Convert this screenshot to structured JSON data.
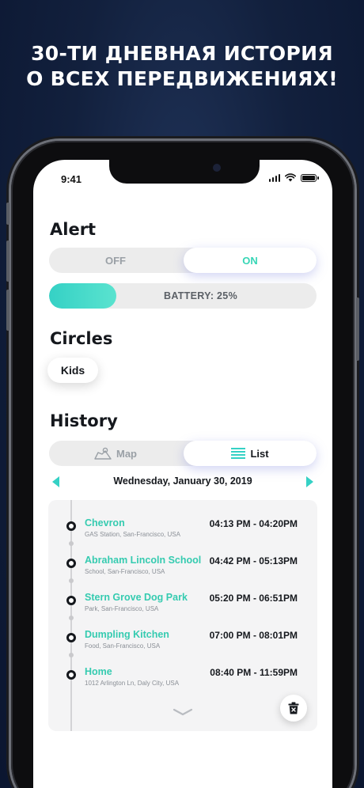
{
  "promo": {
    "line1": "30-ТИ ДНЕВНАЯ ИСТОРИЯ",
    "line2": "О ВСЕХ ПЕРЕДВИЖЕНИЯХ!"
  },
  "status_bar": {
    "time": "9:41"
  },
  "alert": {
    "title": "Alert",
    "off_label": "OFF",
    "on_label": "ON",
    "selected": "ON"
  },
  "battery": {
    "label": "BATTERY: 25%",
    "level_percent": 25
  },
  "circles": {
    "title": "Circles",
    "items": [
      "Kids"
    ]
  },
  "history": {
    "title": "History",
    "view_map_label": "Map",
    "view_list_label": "List",
    "selected_view": "List",
    "date": "Wednesday, January 30, 2019",
    "entries": [
      {
        "place": "Chevron",
        "address": "GAS Station, San-Francisco, USA",
        "time": "04:13 PM - 04:20PM"
      },
      {
        "place": "Abraham Lincoln School",
        "address": "School, San-Francisco, USA",
        "time": "04:42 PM - 05:13PM"
      },
      {
        "place": "Stern Grove Dog Park",
        "address": "Park, San-Francisco, USA",
        "time": "05:20 PM - 06:51PM"
      },
      {
        "place": "Dumpling Kitchen",
        "address": "Food, San-Francisco, USA",
        "time": "07:00 PM - 08:01PM"
      },
      {
        "place": "Home",
        "address": "1012 Arlington Ln, Daly City, USA",
        "time": "08:40 PM - 11:59PM"
      }
    ]
  },
  "colors": {
    "accent": "#35d1c5",
    "accent_text": "#35cbb0",
    "background": "#12203d"
  }
}
